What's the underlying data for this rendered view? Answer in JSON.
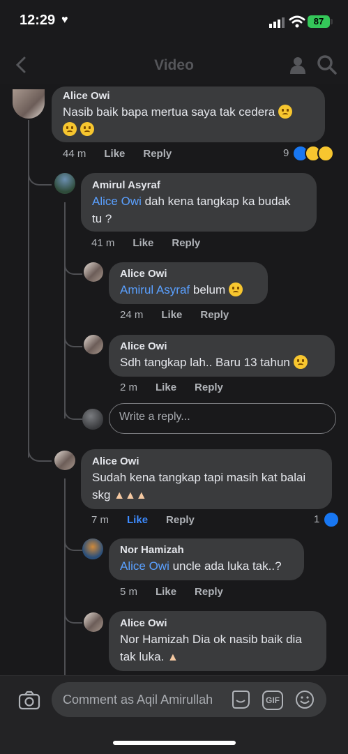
{
  "status": {
    "time": "12:29",
    "battery": "87"
  },
  "header": {
    "title": "Video"
  },
  "comments": [
    {
      "name": "Alice Owi",
      "text": "Nasib baik bapa mertua saya tak cedera",
      "time": "44 m",
      "like": "Like",
      "reply": "Reply",
      "reactions": "9"
    },
    {
      "name": "Amirul Asyraf",
      "mention": "Alice Owi",
      "text": " dah kena tangkap ka budak",
      "text2": "tu ?",
      "time": "41 m",
      "like": "Like",
      "reply": "Reply"
    },
    {
      "name": "Alice Owi",
      "mention": "Amirul Asyraf",
      "text": " belum",
      "time": "24 m",
      "like": "Like",
      "reply": "Reply"
    },
    {
      "name": "Alice Owi",
      "text": "Sdh tangkap lah.. Baru 13 tahun",
      "time": "2 m",
      "like": "Like",
      "reply": "Reply"
    },
    {
      "name": "Alice Owi",
      "text": "Sudah kena tangkap tapi masih kat balai",
      "text2": "skg",
      "time": "7 m",
      "like": "Like",
      "reply": "Reply",
      "reactions": "1"
    },
    {
      "name": "Nor Hamizah",
      "mention": "Alice Owi",
      "text": " uncle ada luka tak..?",
      "time": "5 m",
      "like": "Like",
      "reply": "Reply"
    },
    {
      "name": "Alice Owi",
      "text": "Nor Hamizah Dia ok nasib baik dia",
      "text2": "tak luka.",
      "time": "",
      "like": "",
      "reply": ""
    }
  ],
  "reply_box": {
    "placeholder": "Write a reply..."
  },
  "composer": {
    "placeholder": "Comment as Aqil Amirullah",
    "gif": "GIF"
  },
  "colors": {
    "background": "#19191b",
    "bubble": "#3a3b3d",
    "mention": "#5aa0ff",
    "like_active": "#3d8bff",
    "battery": "#34c759"
  }
}
